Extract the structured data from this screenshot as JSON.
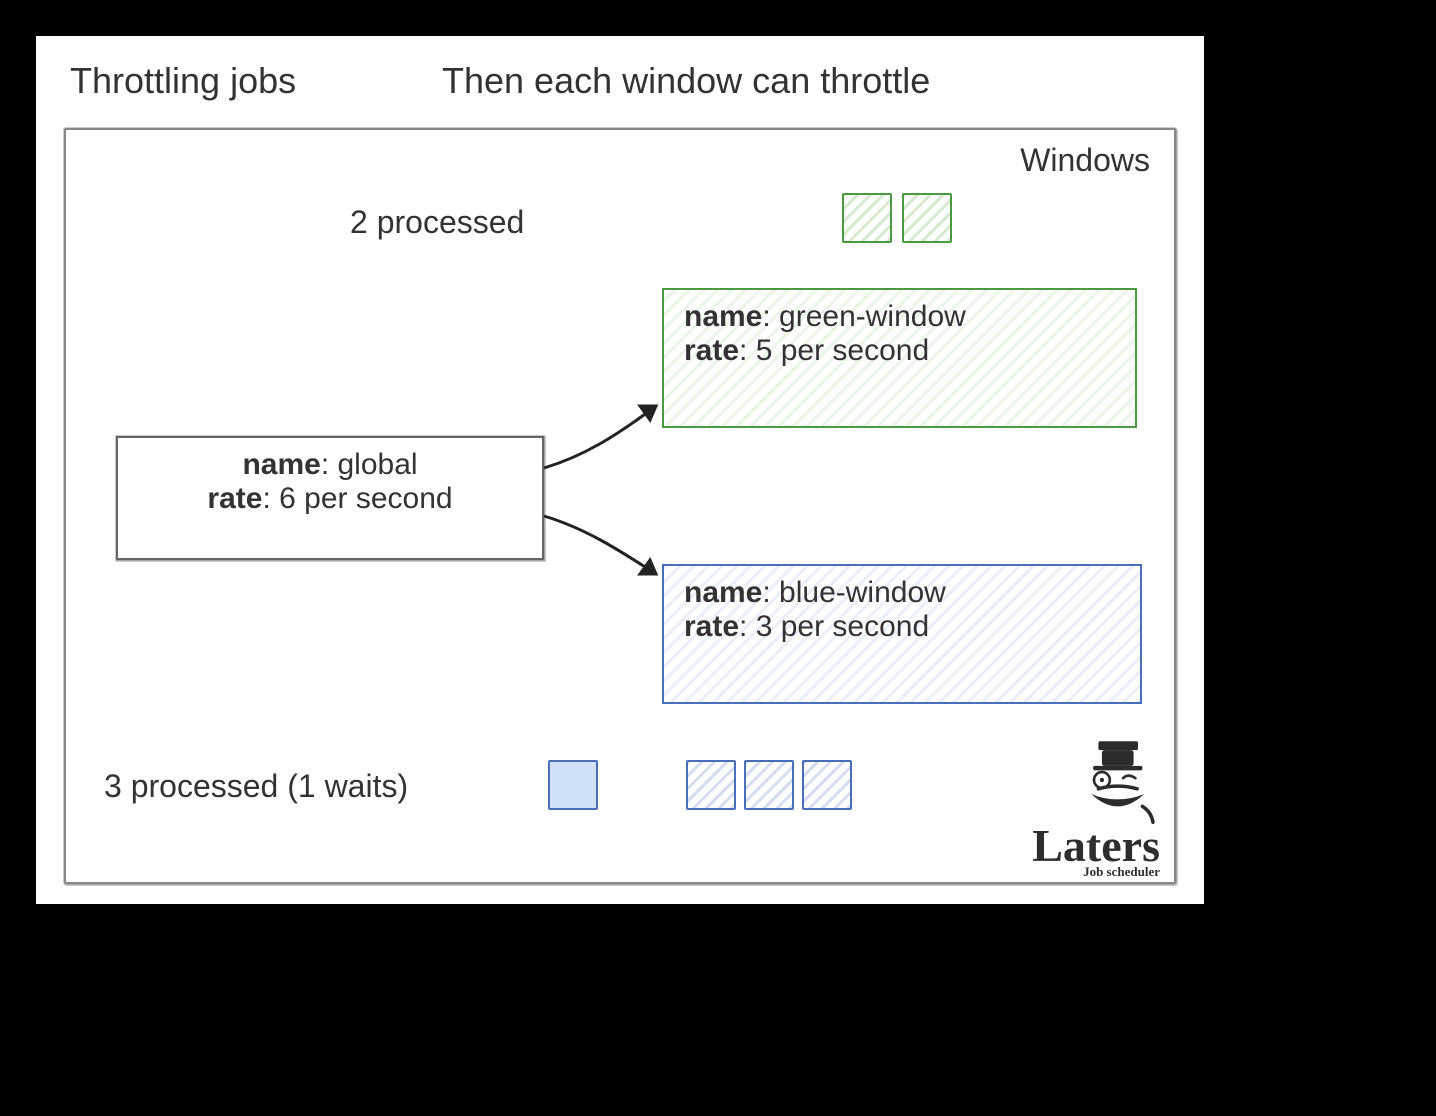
{
  "headings": {
    "left": "Throttling jobs",
    "right": "Then each window can throttle",
    "windows": "Windows"
  },
  "global": {
    "name_label": "name",
    "name_value": "global",
    "rate_label": "rate",
    "rate_value": "6 per second"
  },
  "green": {
    "name_label": "name",
    "name_value": "green-window",
    "rate_label": "rate",
    "rate_value": "5 per second",
    "processed_text": "2 processed"
  },
  "blue": {
    "name_label": "name",
    "name_value": "blue-window",
    "rate_label": "rate",
    "rate_value": "3 per second",
    "processed_text": "3 processed (1 waits)"
  },
  "logo": {
    "brand": "Laters",
    "sub": "Job scheduler"
  }
}
